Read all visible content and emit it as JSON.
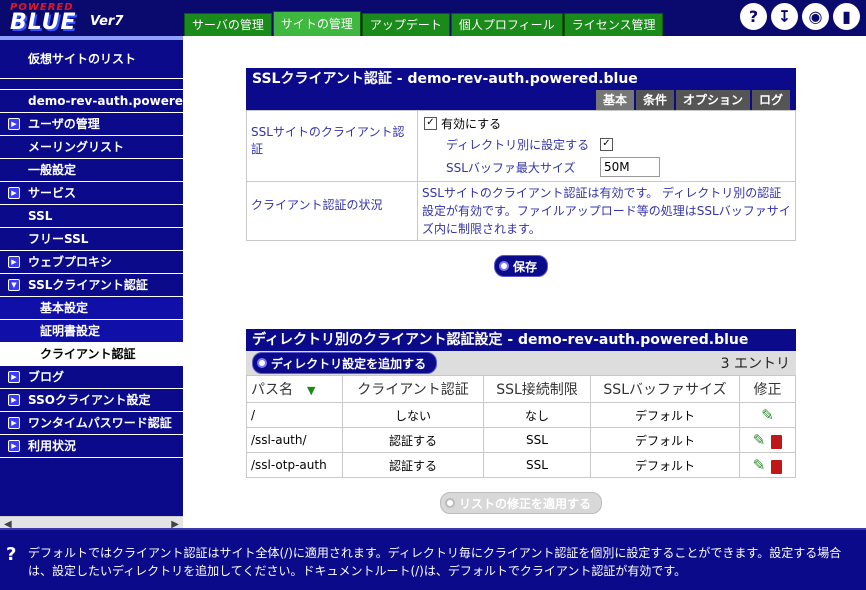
{
  "logo": {
    "powered": "POWERED",
    "brand": "BLUE",
    "version": "Ver7"
  },
  "tabs": [
    "サーバの管理",
    "サイトの管理",
    "アップデート",
    "個人プロフィール",
    "ライセンス管理"
  ],
  "header_icons": [
    "help-icon",
    "download-icon",
    "eye-icon",
    "logout-icon"
  ],
  "sidebar": {
    "items": [
      {
        "label": "仮想サイトのリスト",
        "type": "first"
      },
      {
        "label": "demo-rev-auth.powered",
        "type": "plain"
      },
      {
        "label": "ユーザの管理",
        "type": "expand"
      },
      {
        "label": "メーリングリスト",
        "type": "plain"
      },
      {
        "label": "一般設定",
        "type": "plain"
      },
      {
        "label": "サービス",
        "type": "expand"
      },
      {
        "label": "SSL",
        "type": "plain"
      },
      {
        "label": "フリーSSL",
        "type": "plain"
      },
      {
        "label": "ウェブプロキシ",
        "type": "expand"
      },
      {
        "label": "SSLクライアント認証",
        "type": "open"
      },
      {
        "label": "基本設定",
        "type": "sub"
      },
      {
        "label": "証明書設定",
        "type": "sub"
      },
      {
        "label": "クライアント認証",
        "type": "selected"
      },
      {
        "label": "ブログ",
        "type": "expand"
      },
      {
        "label": "SSOクライアント設定",
        "type": "expand"
      },
      {
        "label": "ワンタイムパスワード認証",
        "type": "expand"
      },
      {
        "label": "利用状況",
        "type": "expand"
      }
    ]
  },
  "panel1": {
    "title": "SSLクライアント認証 - demo-rev-auth.powered.blue",
    "tabs": [
      "基本",
      "条件",
      "オプション",
      "ログ"
    ],
    "row1_label": "SSLサイトのクライアント認証",
    "enable_label": "有効にする",
    "per_dir_label": "ディレクトリ別に設定する",
    "buffer_label": "SSLバッファ最大サイズ",
    "buffer_value": "50M",
    "row2_label": "クライアント認証の状況",
    "status_text": "SSLサイトのクライアント認証は有効です。 ディレクトリ別の認証設定が有効です。ファイルアップロード等の処理はSSLバッファサイズ内に制限されます。",
    "save_label": "保存"
  },
  "panel2": {
    "title": "ディレクトリ別のクライアント認証設定 - demo-rev-auth.powered.blue",
    "add_label": "ディレクトリ設定を追加する",
    "entry_count": "3 エントリ",
    "columns": [
      "パス名",
      "クライアント認証",
      "SSL接続制限",
      "SSLバッファサイズ",
      "修正"
    ],
    "rows": [
      {
        "path": "/",
        "auth": "しない",
        "ssl": "なし",
        "buffer": "デフォルト",
        "delete": false
      },
      {
        "path": "/ssl-auth/",
        "auth": "認証する",
        "ssl": "SSL",
        "buffer": "デフォルト",
        "delete": true
      },
      {
        "path": "/ssl-otp-auth",
        "auth": "認証する",
        "ssl": "SSL",
        "buffer": "デフォルト",
        "delete": true
      }
    ],
    "apply_label": "リストの修正を適用する"
  },
  "footer": {
    "text": "デフォルトではクライアント認証はサイト全体(/)に適用されます。ディレクトリ毎にクライアント認証を個別に設定することができます。設定する場合は、設定したいディレクトリを追加してください。ドキュメントルート(/)は、デフォルトでクライアント認証が有効です。"
  }
}
